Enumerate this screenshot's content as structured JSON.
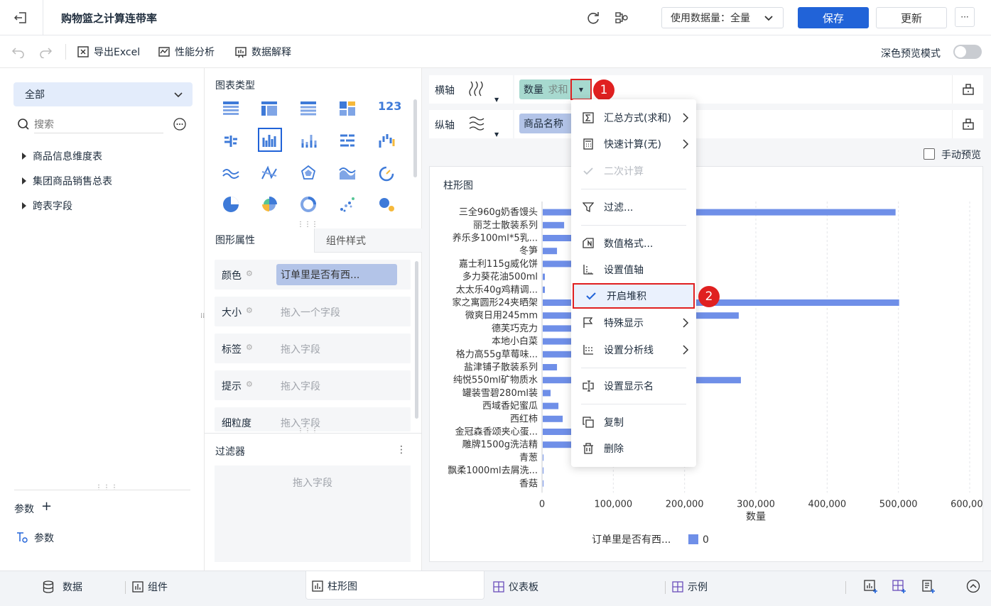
{
  "header": {
    "title": "购物篮之计算连带率",
    "data_usage_label": "使用数据量：全量",
    "save_label": "保存",
    "update_label": "更新",
    "more_label": "···"
  },
  "toolbar": {
    "export_excel": "导出Excel",
    "performance": "性能分析",
    "data_explain": "数据解释",
    "dark_preview": "深色预览模式"
  },
  "left": {
    "scope_select": "全部",
    "search_placeholder": "搜索",
    "tree": [
      "商品信息维度表",
      "集团商品销售总表",
      "跨表字段"
    ],
    "params_title": "参数",
    "param_item": "参数"
  },
  "mid": {
    "chart_type_title": "图表类型",
    "tab_props": "图形属性",
    "tab_style": "组件样式",
    "props": [
      {
        "label": "颜色",
        "value": "订单里是否有西..."
      },
      {
        "label": "大小",
        "value": "拖入一个字段"
      },
      {
        "label": "标签",
        "value": "拖入字段"
      },
      {
        "label": "提示",
        "value": "拖入字段"
      },
      {
        "label": "细粒度",
        "value": "拖入字段"
      }
    ],
    "filter_title": "过滤器",
    "filter_placeholder": "拖入字段"
  },
  "axes": {
    "x_label": "横轴",
    "x_field": "数量",
    "x_agg": "求和",
    "y_label": "纵轴",
    "y_field": "商品名称",
    "manual_preview": "手动预览"
  },
  "context_menu": {
    "items": [
      {
        "label": "汇总方式(求和)",
        "icon": "sigma-icon",
        "submenu": true
      },
      {
        "label": "快速计算(无)",
        "icon": "calculator-icon",
        "submenu": true
      },
      {
        "label": "二次计算",
        "icon": "check-icon",
        "disabled": true
      },
      {
        "label": "过滤...",
        "icon": "filter-icon"
      },
      {
        "label": "数值格式...",
        "icon": "number-format-icon"
      },
      {
        "label": "设置值轴",
        "icon": "axis-icon"
      },
      {
        "label": "开启堆积",
        "icon": "check-icon",
        "highlight": true
      },
      {
        "label": "特殊显示",
        "icon": "flag-icon",
        "submenu": true
      },
      {
        "label": "设置分析线",
        "icon": "analysis-line-icon",
        "submenu": true
      },
      {
        "label": "设置显示名",
        "icon": "rename-icon"
      },
      {
        "label": "复制",
        "icon": "copy-icon"
      },
      {
        "label": "删除",
        "icon": "trash-icon"
      }
    ],
    "badge1": "1",
    "badge2": "2"
  },
  "chart_data": {
    "type": "bar",
    "title": "柱形图",
    "orientation": "horizontal",
    "categories": [
      "三全960g奶香馒头",
      "丽芝士散装系列",
      "养乐多100ml*5乳...",
      "冬笋",
      "嘉士利115g威化饼",
      "多力葵花油500ml",
      "太太乐40g鸡精调...",
      "家之寓圆形24夹晒架",
      "微爽日用245mm",
      "德芙巧克力",
      "本地小白菜",
      "格力高55g草莓味...",
      "盐津铺子散装系列",
      "纯悦550ml矿物质水",
      "罐装雪碧280ml装",
      "西域香妃蜜瓜",
      "西红柿",
      "金冠森香颂夹心蛋...",
      "雕牌1500g洗洁精",
      "青葱",
      "飘柔1000ml去屑洗...",
      "香菇"
    ],
    "series": [
      {
        "name": "0",
        "values": [
          495000,
          30000,
          42000,
          20000,
          48000,
          3000,
          3000,
          500000,
          275000,
          48000,
          46000,
          47000,
          20000,
          278000,
          11000,
          22000,
          28000,
          48000,
          48000,
          1000,
          1000,
          1000
        ]
      }
    ],
    "xlabel": "数量",
    "xlim": [
      0,
      600000
    ],
    "xticks": [
      "0",
      "100,000",
      "200,000",
      "300,000",
      "400,000",
      "500,000",
      "600,000"
    ],
    "legend_title": "订单里是否有西...",
    "legend_position": "bottom",
    "bar_color": "#6f8fe8"
  },
  "bottom": {
    "data_tab": "数据",
    "component_tab": "组件",
    "chart_tab": "柱形图",
    "dashboard_tab": "仪表板",
    "example_tab": "示例"
  }
}
